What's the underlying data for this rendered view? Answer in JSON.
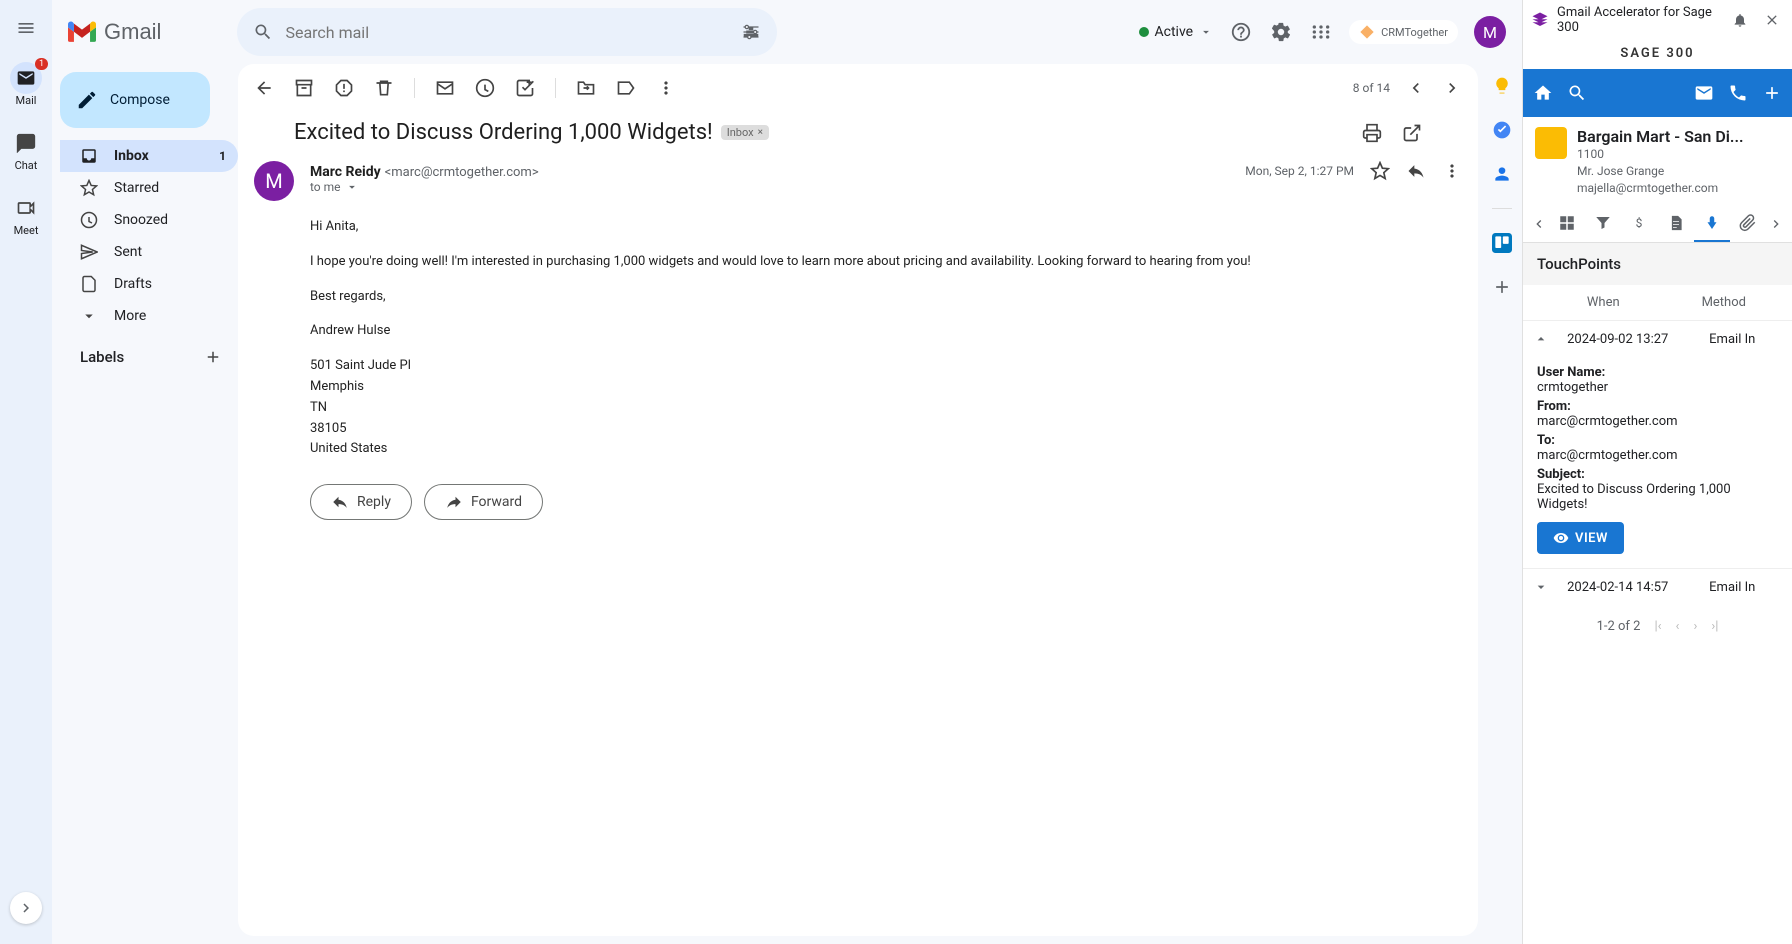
{
  "rail": {
    "mail": "Mail",
    "chat": "Chat",
    "meet": "Meet",
    "mail_badge": "1"
  },
  "logo_text": "Gmail",
  "search": {
    "placeholder": "Search mail"
  },
  "status": {
    "label": "Active"
  },
  "crm_chip": "CRMTogether",
  "avatar_letter": "M",
  "sidebar": {
    "compose": "Compose",
    "items": {
      "inbox": "Inbox",
      "inbox_count": "1",
      "starred": "Starred",
      "snoozed": "Snoozed",
      "sent": "Sent",
      "drafts": "Drafts",
      "more": "More"
    },
    "labels_header": "Labels"
  },
  "toolbar": {
    "pager": "8 of 14"
  },
  "message": {
    "subject": "Excited to Discuss Ordering 1,000 Widgets!",
    "inbox_chip": "Inbox",
    "sender_name": "Marc Reidy",
    "sender_email": "<marc@crmtogether.com>",
    "to": "to me",
    "date": "Mon, Sep 2, 1:27 PM",
    "avatar_letter": "M",
    "body": {
      "greeting": "Hi Anita,",
      "para1": "I hope you're doing well! I'm interested in purchasing 1,000 widgets and would love to learn more about pricing and availability. Looking forward to hearing from you!",
      "regards": "Best regards,",
      "signer": "Andrew Hulse",
      "addr1": "501 Saint Jude Pl",
      "addr2": "Memphis",
      "addr3": "TN",
      "addr4": "38105",
      "addr5": "United States"
    },
    "reply": "Reply",
    "forward": "Forward"
  },
  "panel": {
    "title": "Gmail Accelerator for Sage 300",
    "brand": "SAGE 300",
    "company": {
      "name": "Bargain Mart - San Di...",
      "code": "1100",
      "contact": "Mr. Jose Grange",
      "email": "majella@crmtogether.com"
    },
    "section": "TouchPoints",
    "table": {
      "when": "When",
      "method": "Method"
    },
    "rows": [
      {
        "when": "2024-09-02 13:27",
        "method": "Email In",
        "detail": {
          "user_label": "User Name:",
          "user": "crmtogether",
          "from_label": "From:",
          "from": "marc@crmtogether.com",
          "to_label": "To:",
          "to": "marc@crmtogether.com",
          "subject_label": "Subject:",
          "subject": "Excited to Discuss Ordering 1,000 Widgets!",
          "view": "VIEW"
        }
      },
      {
        "when": "2024-02-14 14:57",
        "method": "Email In"
      }
    ],
    "pager": "1-2 of 2"
  }
}
